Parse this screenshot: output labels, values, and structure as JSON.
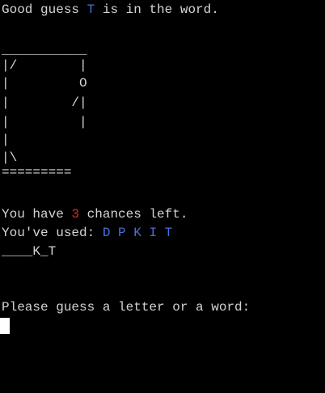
{
  "message": {
    "prefix": "Good guess ",
    "letter": "T",
    "suffix": " is in the word."
  },
  "gallows": [
    "___________",
    "|/        |",
    "|         O",
    "|        /|",
    "|         |",
    "|",
    "|\\",
    "========="
  ],
  "chances": {
    "prefix": "You have ",
    "count": "3",
    "suffix": " chances left."
  },
  "used": {
    "label": "You've used: ",
    "letters": "D P K I T"
  },
  "word_progress": "____K_T",
  "prompt": "Please guess a letter or a word:",
  "colors": {
    "background": "#000000",
    "text": "#d4d4d4",
    "highlight_blue": "#4a6fd8",
    "highlight_red": "#e02b1f"
  }
}
